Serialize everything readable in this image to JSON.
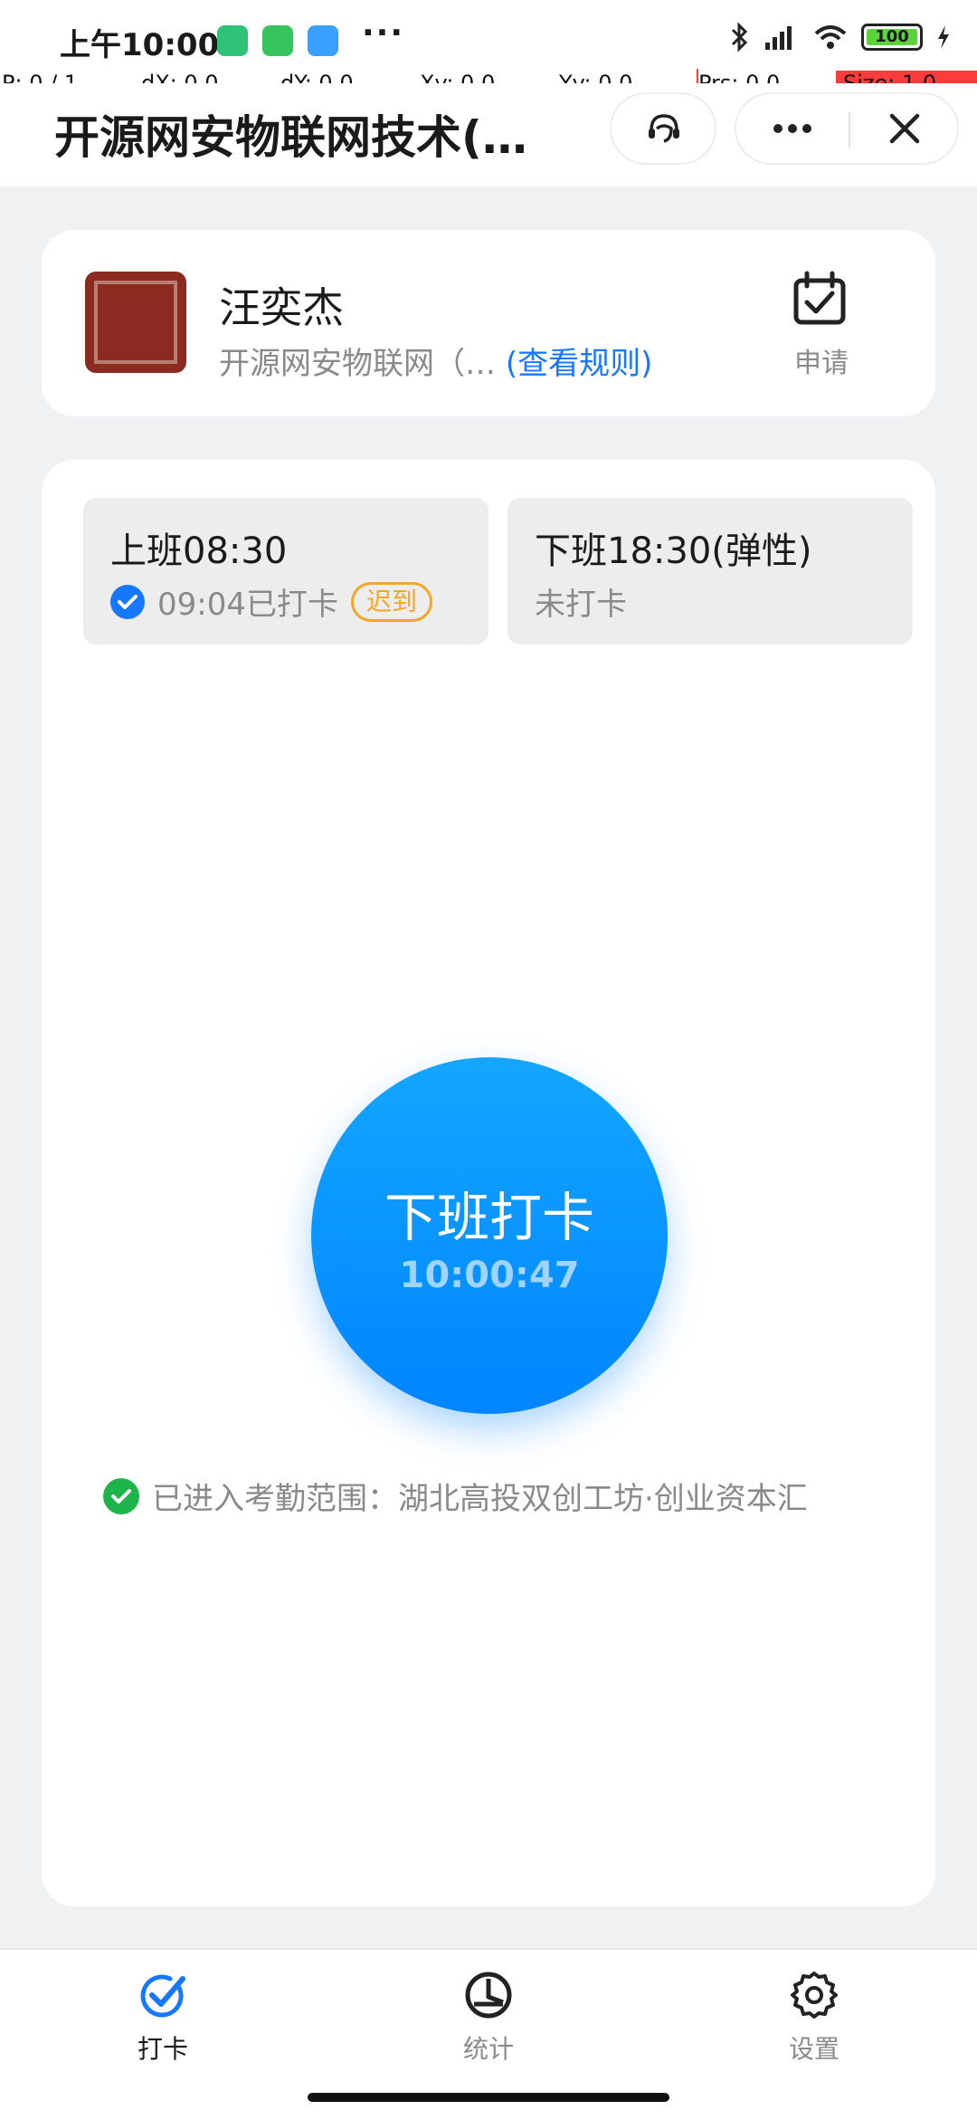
{
  "status_bar": {
    "time": "上午10:00",
    "battery": "100"
  },
  "pointer_overlay": {
    "p": "P: 0 / 1",
    "dx": "dX: 0.0",
    "dy": "dY: 0.0",
    "xv": "Xv: 0.0",
    "yv": "Yv: 0.0",
    "prs": "Prs: 0.0",
    "size": "Size: 1.0"
  },
  "header": {
    "title": "开源网安物联网技术(…"
  },
  "user": {
    "name": "汪奕杰",
    "company": "开源网安物联网（…",
    "rules_link": "(查看规则)",
    "apply_label": "申请"
  },
  "shifts": {
    "on": {
      "title": "上班08:30",
      "status": "09:04已打卡",
      "badge": "迟到"
    },
    "off": {
      "title": "下班18:30(弹性)",
      "status": "未打卡"
    }
  },
  "punch": {
    "label": "下班打卡",
    "time": "10:00:47"
  },
  "range": {
    "text": "已进入考勤范围：湖北高投双创工坊·创业资本汇"
  },
  "tabs": [
    {
      "label": "打卡"
    },
    {
      "label": "统计"
    },
    {
      "label": "设置"
    }
  ],
  "colors": {
    "accent": "#1677ff",
    "late": "#f5a623",
    "ok": "#1db54a"
  }
}
